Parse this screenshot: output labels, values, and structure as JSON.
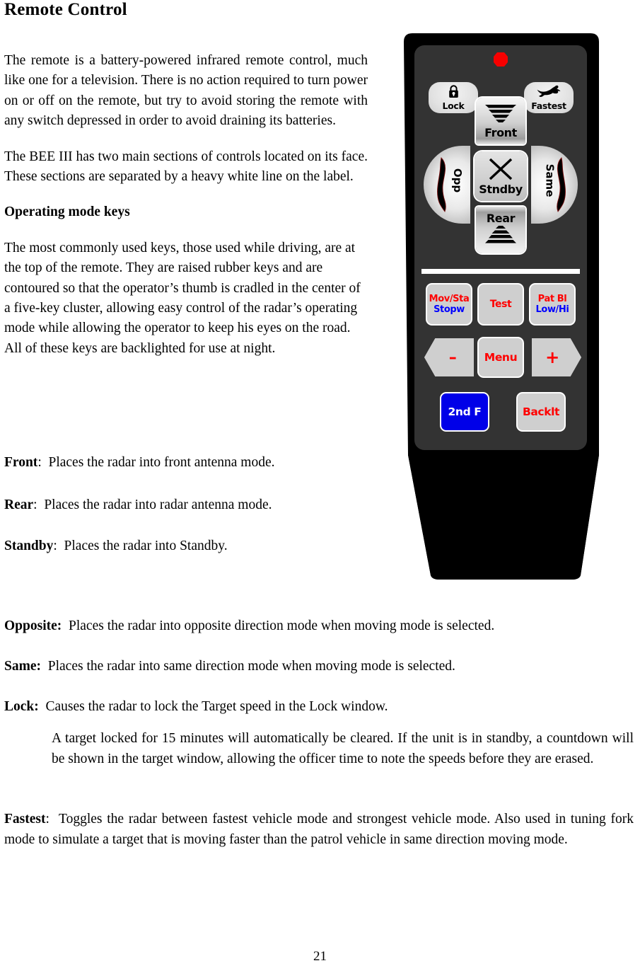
{
  "document": {
    "title": "Remote Control",
    "page_number": "21"
  },
  "body": {
    "intro_paragraph": "The remote is a battery-powered infrared remote control, much like one for a television.  There is no action required to turn power on or off on the remote, but try to avoid storing the remote with any switch depressed in order to avoid draining its batteries.",
    "sections_paragraph": "The BEE III has two main sections of controls located on its face.  These sections are separated by a heavy white line on the label.",
    "operating_mode_heading": "Operating mode keys",
    "operating_mode_paragraph": "The most commonly used keys, those used while driving, are at the top of the remote.  They are raised rubber keys and are contoured so that the operator’s thumb is cradled in the center of a five-key cluster, allowing easy control of the radar’s operating mode while allowing the operator to keep his eyes on the road.  All of these keys are backlighted for use at night."
  },
  "definitions": [
    {
      "term": "Front",
      "separator": ":",
      "description": "Places the radar into front antenna mode."
    },
    {
      "term": "Rear",
      "separator": ":",
      "description": "Places the radar into radar antenna mode."
    },
    {
      "term": "Standby",
      "separator": ":",
      "description": "Places the radar into Standby."
    },
    {
      "term": "Opposite:",
      "separator": "",
      "description": "Places the radar into opposite direction mode when moving mode is selected."
    },
    {
      "term": "Same:",
      "separator": "",
      "description": "Places the radar into same direction mode when moving mode is selected."
    },
    {
      "term": "Lock:",
      "separator": "",
      "description": "Causes the radar to lock the Target speed in the Lock window."
    }
  ],
  "lock_note": "A target locked for 15 minutes will automatically be cleared.  If the unit is in standby, a countdown will be shown in the target window, allowing the officer time to note the speeds before they are erased.",
  "fastest": {
    "term": "Fastest",
    "separator": ":",
    "description": "Toggles the radar between fastest vehicle mode and strongest vehicle mode.  Also used in tuning fork mode to simulate a target that is moving faster than the patrol vehicle in same direction moving mode."
  },
  "remote_illustration": {
    "name": "BEE III infrared remote control",
    "colors": {
      "body": "#000000",
      "face_panel": "#333333",
      "led": "#f70000",
      "key_face": "#cfcfcf",
      "divider": "#ffffff",
      "label_red": "#ff0000",
      "label_blue": "#0000ff",
      "second_function_bg": "#0000e8"
    },
    "keys": {
      "lock": {
        "label": "Lock",
        "icon": "padlock-icon"
      },
      "fastest": {
        "label": "Fastest",
        "icon": "rabbit-icon"
      },
      "front": {
        "label": "Front",
        "icon": "front-antenna-beam-icon"
      },
      "rear": {
        "label": "Rear",
        "icon": "rear-antenna-beam-icon"
      },
      "standby": {
        "label": "Stndby",
        "icon": "x-icon"
      },
      "opposite": {
        "label": "Opp",
        "icon": "opposite-direction-icon"
      },
      "same": {
        "label": "Same",
        "icon": "same-direction-icon"
      },
      "moving_stationary": {
        "label_primary": "Mov/Sta",
        "label_secondary": "Stopw"
      },
      "test": {
        "label": "Test"
      },
      "patrol_blank": {
        "label_primary": "Pat Bl",
        "label_secondary": "Low/Hi"
      },
      "minus": {
        "label": "–",
        "icon": "left-arrow-icon"
      },
      "menu": {
        "label": "Menu"
      },
      "plus": {
        "label": "+",
        "icon": "right-arrow-icon"
      },
      "second_function": {
        "label": "2nd F"
      },
      "backlight": {
        "label": "Backlt"
      }
    }
  }
}
